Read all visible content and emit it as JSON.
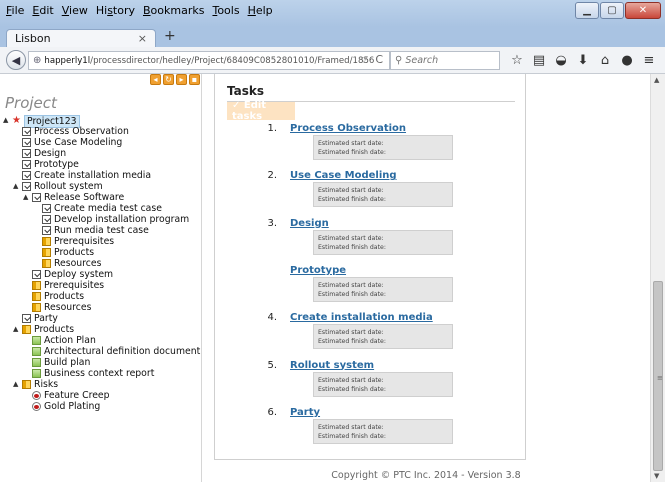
{
  "menu": [
    "File",
    "Edit",
    "View",
    "History",
    "Bookmarks",
    "Tools",
    "Help"
  ],
  "menu_underline": [
    "F",
    "E",
    "V",
    "s",
    "B",
    "T",
    "H"
  ],
  "tab": {
    "title": "Lisbon",
    "close": "×",
    "new_tab": "+"
  },
  "nav": {
    "url_host": "happerly1l",
    "url_path": "/processdirector/hedley/Project/68409C0852801010/Framed/1856",
    "search_placeholder": "Search",
    "icons": [
      "star-icon",
      "bookmarks-list-icon",
      "pocket-icon",
      "download-icon",
      "home-icon",
      "chat-icon",
      "menu-icon"
    ]
  },
  "left": {
    "title": "Project",
    "tree": [
      {
        "label": "Project123",
        "icon": "project",
        "level": 0,
        "toggle": "▲",
        "selected": true
      },
      {
        "label": "Process Observation",
        "icon": "task",
        "level": 1
      },
      {
        "label": "Use Case Modeling",
        "icon": "task",
        "level": 1
      },
      {
        "label": "Design",
        "icon": "task",
        "level": 1
      },
      {
        "label": "Prototype",
        "icon": "task",
        "level": 1
      },
      {
        "label": "Create installation media",
        "icon": "task",
        "level": 1
      },
      {
        "label": "Rollout system",
        "icon": "task",
        "level": 1,
        "toggle": "▲"
      },
      {
        "label": "Release Software",
        "icon": "task",
        "level": 2,
        "toggle": "▲"
      },
      {
        "label": "Create media test case",
        "icon": "task",
        "level": 3
      },
      {
        "label": "Develop installation program",
        "icon": "task",
        "level": 3
      },
      {
        "label": "Run media test case",
        "icon": "task",
        "level": 3
      },
      {
        "label": "Prerequisites",
        "icon": "folder",
        "level": 3
      },
      {
        "label": "Products",
        "icon": "folder",
        "level": 3
      },
      {
        "label": "Resources",
        "icon": "folder",
        "level": 3
      },
      {
        "label": "Deploy system",
        "icon": "task",
        "level": 2
      },
      {
        "label": "Prerequisites",
        "icon": "folder",
        "level": 2
      },
      {
        "label": "Products",
        "icon": "folder",
        "level": 2
      },
      {
        "label": "Resources",
        "icon": "folder",
        "level": 2
      },
      {
        "label": "Party",
        "icon": "task",
        "level": 1
      },
      {
        "label": "Products",
        "icon": "folder",
        "level": 1,
        "toggle": "▲"
      },
      {
        "label": "Action Plan",
        "icon": "doc",
        "level": 2
      },
      {
        "label": "Architectural definition document",
        "icon": "doc",
        "level": 2
      },
      {
        "label": "Build plan",
        "icon": "doc",
        "level": 2
      },
      {
        "label": "Business context report",
        "icon": "doc",
        "level": 2
      },
      {
        "label": "Risks",
        "icon": "folder",
        "level": 1,
        "toggle": "▲"
      },
      {
        "label": "Feature Creep",
        "icon": "risk",
        "level": 2
      },
      {
        "label": "Gold Plating",
        "icon": "risk",
        "level": 2
      }
    ]
  },
  "main": {
    "title": "Tasks",
    "edit_label": "✓ Edit tasks",
    "start_label": "Estimated start date:",
    "finish_label": "Estimated finish date:",
    "tasks": [
      {
        "num": "1.",
        "name": "Process Observation"
      },
      {
        "num": "2.",
        "name": "Use Case Modeling"
      },
      {
        "num": "3.",
        "name": "Design"
      },
      {
        "num": "",
        "name": "Prototype"
      },
      {
        "num": "4.",
        "name": "Create installation media"
      },
      {
        "num": "5.",
        "name": "Rollout system"
      },
      {
        "num": "6.",
        "name": "Party"
      }
    ],
    "footer": "Copyright © PTC Inc. 2014 - Version 3.8"
  }
}
